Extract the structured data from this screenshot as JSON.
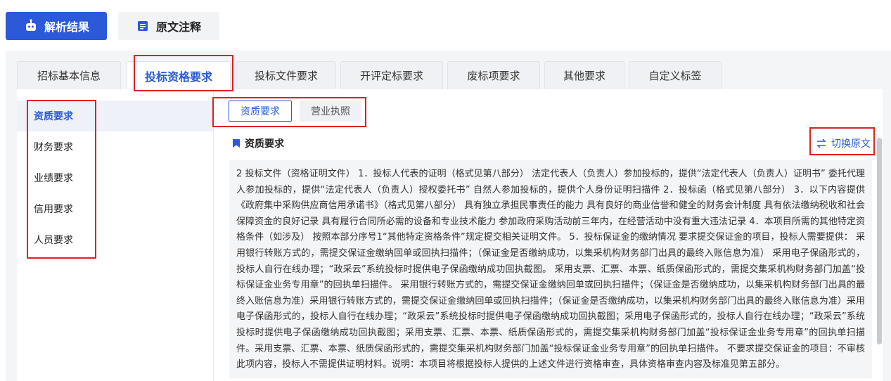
{
  "top_buttons": {
    "result": {
      "label": "解析结果",
      "icon": "robot-icon"
    },
    "original": {
      "label": "原文注释",
      "icon": "document-icon"
    }
  },
  "tabs": [
    {
      "label": "招标基本信息",
      "active": false
    },
    {
      "label": "投标资格要求",
      "active": true
    },
    {
      "label": "投标文件要求",
      "active": false
    },
    {
      "label": "开评定标要求",
      "active": false
    },
    {
      "label": "废标项要求",
      "active": false
    },
    {
      "label": "其他要求",
      "active": false
    },
    {
      "label": "自定义标签",
      "active": false
    }
  ],
  "left_nav": [
    {
      "label": "资质要求",
      "active": true
    },
    {
      "label": "财务要求",
      "active": false
    },
    {
      "label": "业绩要求",
      "active": false
    },
    {
      "label": "信用要求",
      "active": false
    },
    {
      "label": "人员要求",
      "active": false
    }
  ],
  "sub_tabs": [
    {
      "label": "资质要求",
      "active": true
    },
    {
      "label": "营业执照",
      "active": false
    }
  ],
  "section": {
    "title": "资质要求",
    "switch_label": "切换原文",
    "switch_icon": "swap-icon",
    "content": "2 投标文件（资格证明文件） 1．投标人代表的证明（格式见第八部分） 法定代表人（负责人）参加投标的，提供“法定代表人（负责人）证明书” 委托代理人参加投标的，提供“法定代表人（负责人）授权委托书” 自然人参加投标的，提供个人身份证明扫描件 2．投标函（格式见第八部分） 3．以下内容提供《政府集中采购供应商信用承诺书》（格式见第八部分） 具有独立承担民事责任的能力 具有良好的商业信誉和健全的财务会计制度 具有依法缴纳税收和社会保障资金的良好记录 具有履行合同所必需的设备和专业技术能力 参加政府采购活动前三年内，在经营活动中没有重大违法记录 4．本项目所需的其他特定资格条件（如涉及） 按照本部分序号1“其他特定资格条件”规定提交相关证明文件。 5．投标保证金的缴纳情况 要求提交保证金的项目，投标人需要提供： 采用银行转账方式的，需提交保证金缴纳回单或回执扫描件；（保证金是否缴纳成功，以集采机构财务部门出具的最终入账信息为准） 采用电子保函形式的，投标人自行在线办理；“政采云”系统投标时提供电子保函缴纳成功回执截图。 采用支票、汇票、本票、纸质保函形式的，需提交集采机构财务部门加盖“投标保证金业务专用章”的回执单扫描件。 采用银行转账方式的，需提交保证金缴纳回单或回执扫描件；（保证金是否缴纳成功，以集采机构财务部门出具的最终入账信息为准）采用银行转账方式的，需提交保证金缴纳回单或回执扫描件；（保证金是否缴纳成功，以集采机构财务部门出具的最终入账信息为准）采用电子保函形式的，投标人自行在线办理；“政采云”系统投标时提供电子保函缴纳成功回执截图；采用电子保函形式的，投标人自行在线办理；“政采云”系统投标时提供电子保函缴纳成功回执截图；采用支票、汇票、本票、纸质保函形式的，需提交集采机构财务部门加盖“投标保证金业务专用章”的回执单扫描件。采用支票、汇票、本票、纸质保函形式的，需提交集采机构财务部门加盖“投标保证金业务专用章”的回执单扫描件。 不要求提交保证金的项目：不审核此项内容，投标人不需提供证明材料。说明：本项目将根据投标人提供的上述文件进行资格审查，具体资格审查内容及标准见第五部分。"
  },
  "colors": {
    "accent": "#2b59d9",
    "highlight_border": "#e02020"
  }
}
